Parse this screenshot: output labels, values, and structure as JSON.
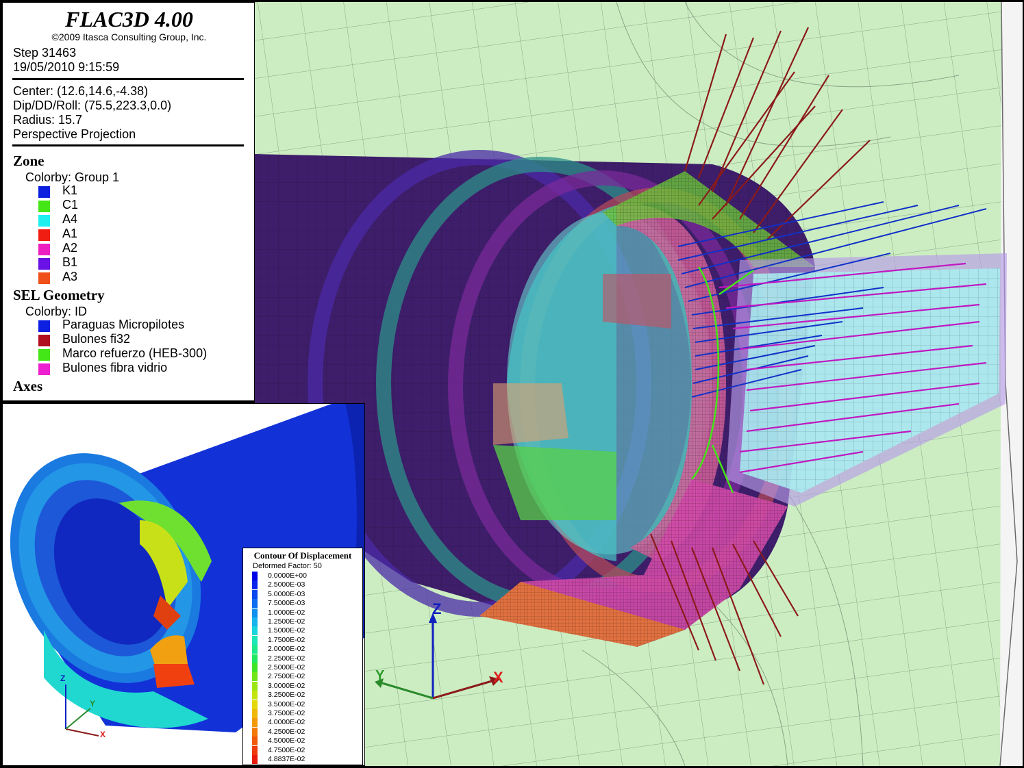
{
  "app_title": "FLAC3D 4.00",
  "copyright": "©2009 Itasca Consulting Group, Inc.",
  "step": "Step 31463",
  "datetime": "19/05/2010 9:15:59",
  "view": {
    "center": "Center: (12.6,14.6,-4.38)",
    "dip": "Dip/DD/Roll: (75.5,223.3,0.0)",
    "radius": "Radius: 15.7",
    "projection": "Perspective Projection"
  },
  "zone": {
    "heading": "Zone",
    "colorby": "Colorby: Group 1",
    "groups": [
      {
        "label": "K1",
        "color": "#0a1fe0"
      },
      {
        "label": "C1",
        "color": "#44e616"
      },
      {
        "label": "A4",
        "color": "#1ef0ef"
      },
      {
        "label": "A1",
        "color": "#f01d12"
      },
      {
        "label": "A2",
        "color": "#ee1fc2"
      },
      {
        "label": "B1",
        "color": "#6a12e6"
      },
      {
        "label": "A3",
        "color": "#f0501a"
      }
    ]
  },
  "sel": {
    "heading": "SEL Geometry",
    "colorby": "Colorby: ID",
    "items": [
      {
        "label": "Paraguas Micropilotes",
        "color": "#0d1fe0"
      },
      {
        "label": "Bulones fi32",
        "color": "#b01020"
      },
      {
        "label": "Marco refuerzo (HEB-300)",
        "color": "#43e616"
      },
      {
        "label": "Bulones fibra vidrio",
        "color": "#ee1fd0"
      }
    ]
  },
  "axes_heading": "Axes",
  "axes_labels": {
    "x": "X",
    "y": "Y",
    "z": "Z"
  },
  "contour": {
    "title": "Contour Of Displacement",
    "subtitle": "Deformed Factor: 50",
    "levels": [
      {
        "label": "0.0000E+00",
        "color": "#0000e6"
      },
      {
        "label": "2.5000E-03",
        "color": "#0525ea"
      },
      {
        "label": "5.0000E-03",
        "color": "#0a48ee"
      },
      {
        "label": "7.5000E-03",
        "color": "#0f6cf0"
      },
      {
        "label": "1.0000E-02",
        "color": "#1290f0"
      },
      {
        "label": "1.2500E-02",
        "color": "#15b4ec"
      },
      {
        "label": "1.5000E-02",
        "color": "#18d4dc"
      },
      {
        "label": "1.7500E-02",
        "color": "#1ae6b8"
      },
      {
        "label": "2.0000E-02",
        "color": "#1ce88c"
      },
      {
        "label": "2.2500E-02",
        "color": "#20e860"
      },
      {
        "label": "2.5000E-02",
        "color": "#40e626"
      },
      {
        "label": "2.7500E-02",
        "color": "#70e618"
      },
      {
        "label": "3.0000E-02",
        "color": "#9ce614"
      },
      {
        "label": "3.2500E-02",
        "color": "#c4e410"
      },
      {
        "label": "3.5000E-02",
        "color": "#e4d80e"
      },
      {
        "label": "3.7500E-02",
        "color": "#f0b80c"
      },
      {
        "label": "4.0000E-02",
        "color": "#f29a0c"
      },
      {
        "label": "4.2500E-02",
        "color": "#f27a0c"
      },
      {
        "label": "4.5000E-02",
        "color": "#f05a0c"
      },
      {
        "label": "4.7500E-02",
        "color": "#ee3a0c"
      },
      {
        "label": "4.8837E-02",
        "color": "#ea1a0c"
      }
    ]
  }
}
